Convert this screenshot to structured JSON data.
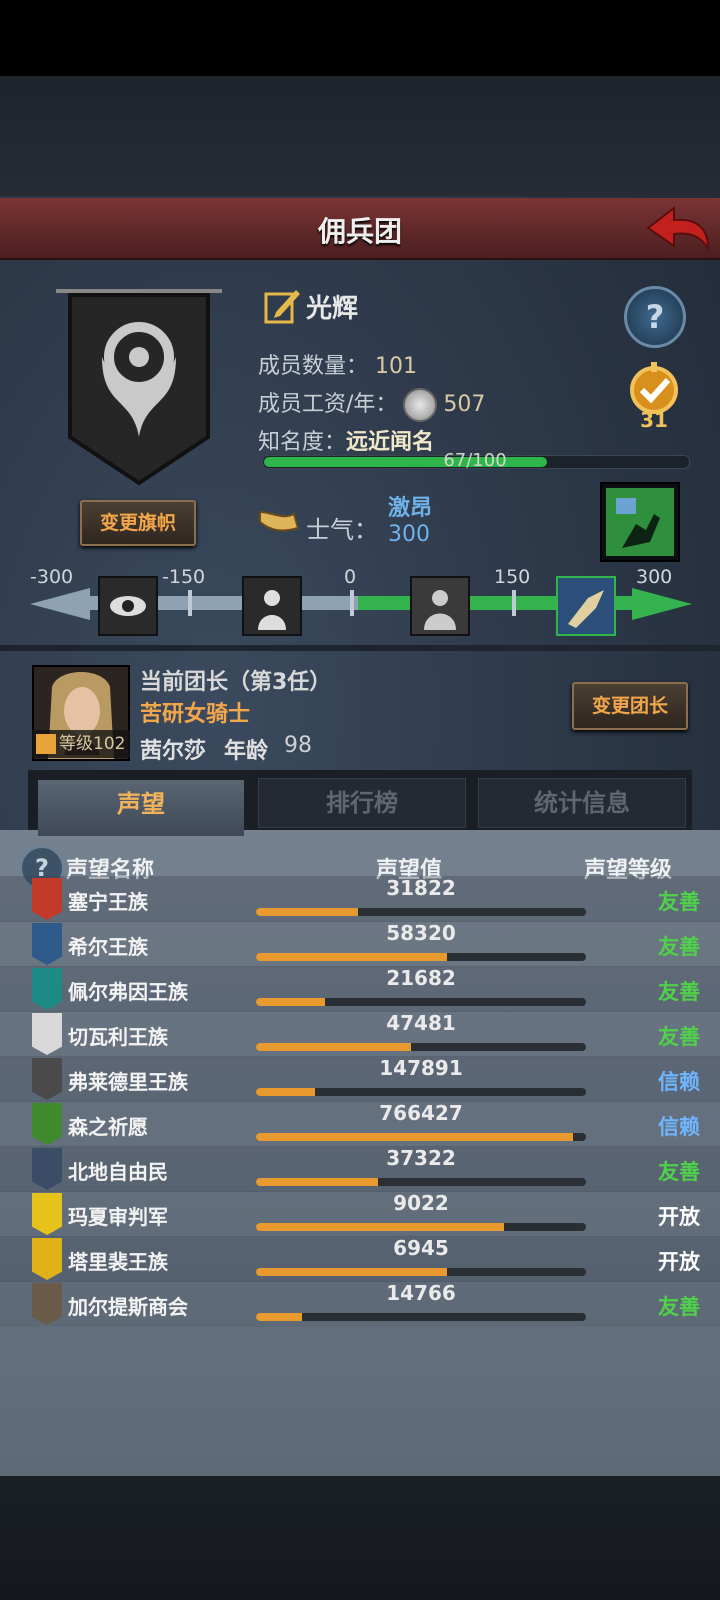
{
  "title": "佣兵团",
  "team": {
    "name": "光辉",
    "members_label": "成员数量：",
    "members": "101",
    "wage_label": "成员工资/年：",
    "wage": "507",
    "fame_label": "知名度：",
    "fame_rank": "远近闻名",
    "fame_text": "67/100",
    "fame_progress": 0.67,
    "medal_count": "31",
    "change_flag": "变更旗帜"
  },
  "morale": {
    "label": "士气：",
    "state": "激昂",
    "value": "300",
    "scale_labels": [
      "-300",
      "-150",
      "0",
      "150",
      "300"
    ]
  },
  "leader": {
    "title": "当前团长（第3任）",
    "class": "苦研女骑士",
    "level": "等级102",
    "name": "茜尔莎",
    "age_label": "年龄",
    "age": "98",
    "change_button": "变更团长"
  },
  "tabs": [
    "声望",
    "排行榜",
    "统计信息"
  ],
  "table": {
    "headers": [
      "声望名称",
      "声望值",
      "声望等级"
    ],
    "rows": [
      {
        "name": "塞宁王族",
        "value": "31822",
        "level": "友善",
        "progress": 0.31,
        "color": "#c33a2a",
        "level_color": "#4fd24a"
      },
      {
        "name": "希尔王族",
        "value": "58320",
        "level": "友善",
        "progress": 0.58,
        "color": "#2f5a8c",
        "level_color": "#4fd24a"
      },
      {
        "name": "佩尔弗因王族",
        "value": "21682",
        "level": "友善",
        "progress": 0.21,
        "color": "#1e8a86",
        "level_color": "#4fd24a"
      },
      {
        "name": "切瓦利王族",
        "value": "47481",
        "level": "友善",
        "progress": 0.47,
        "color": "#d9d9d9",
        "level_color": "#4fd24a"
      },
      {
        "name": "弗莱德里王族",
        "value": "147891",
        "level": "信赖",
        "progress": 0.18,
        "color": "#4a4a4a",
        "level_color": "#6fb6ff"
      },
      {
        "name": "森之祈愿",
        "value": "766427",
        "level": "信赖",
        "progress": 0.96,
        "color": "#3f8a2c",
        "level_color": "#6fb6ff"
      },
      {
        "name": "北地自由民",
        "value": "37322",
        "level": "友善",
        "progress": 0.37,
        "color": "#3a4c66",
        "level_color": "#4fd24a"
      },
      {
        "name": "玛夏审判军",
        "value": "9022",
        "level": "开放",
        "progress": 0.75,
        "color": "#e6c21a",
        "level_color": "#ffffff"
      },
      {
        "name": "塔里裴王族",
        "value": "6945",
        "level": "开放",
        "progress": 0.58,
        "color": "#e0b21a",
        "level_color": "#ffffff"
      },
      {
        "name": "加尔提斯商会",
        "value": "14766",
        "level": "友善",
        "progress": 0.14,
        "color": "#6a5a48",
        "level_color": "#4fd24a"
      }
    ]
  }
}
